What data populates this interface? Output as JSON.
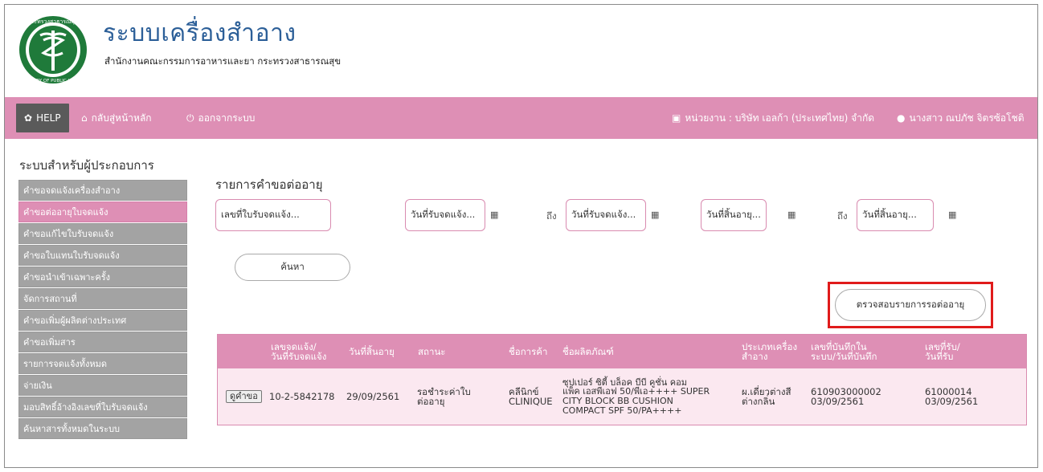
{
  "header": {
    "title": "ระบบเครื่องสำอาง",
    "subtitle": "สำนักงานคณะกรรมการอาหารและยา กระทรวงสาธารณสุข",
    "logo_text": "กระทรวงสาธารณสุข MINISTRY OF PUBLIC HEALTH"
  },
  "navbar": {
    "help": "HELP",
    "home": "กลับสู่หน้าหลัก",
    "logout": "ออกจากระบบ",
    "agency": "หน่วยงาน : บริษัท เอลก้า (ประเทศไทย) จำกัด",
    "user": "นางสาว ณปภัช จิตรซ้อโชติ"
  },
  "sidebar": {
    "title": "ระบบสำหรับผู้ประกอบการ",
    "items": [
      {
        "label": "คำขอจดแจ้งเครื่องสำอาง"
      },
      {
        "label": "คำขอต่ออายุใบจดแจ้ง"
      },
      {
        "label": "คำขอแก้ไขใบรับจดแจ้ง"
      },
      {
        "label": "คำขอใบแทนใบรับจดแจ้ง"
      },
      {
        "label": "คำขอนำเข้าเฉพาะครั้ง"
      },
      {
        "label": "จัดการสถานที่"
      },
      {
        "label": "คำขอเพิ่มผู้ผลิตต่างประเทศ"
      },
      {
        "label": "คำขอเพิ่มสาร"
      },
      {
        "label": "รายการจดแจ้งทั้งหมด"
      },
      {
        "label": "จ่ายเงิน"
      },
      {
        "label": "มอบสิทธิ์อ้างอิงเลขที่ใบรับจดแจ้ง"
      },
      {
        "label": "ค้นหาสารทั้งหมดในระบบ"
      }
    ]
  },
  "main": {
    "title": "รายการคำขอต่ออายุ",
    "filters": {
      "reg_no_placeholder": "เลขที่ใบรับจดแจ้ง...",
      "recv_from_placeholder": "วันที่รับจดแจ้ง...",
      "recv_to_placeholder": "วันที่รับจดแจ้ง...",
      "exp_from_placeholder": "วันที่สิ้นอายุ...",
      "exp_to_placeholder": "วันที่สิ้นอายุ...",
      "to_label": "ถึง"
    },
    "search_button": "ค้นหา",
    "check_button": "ตรวจสอบรายการรอต่ออายุ",
    "table": {
      "headers": {
        "reg": "เลขจดแจ้ง/\nวันที่รับจดแจ้ง",
        "expire": "วันที่สิ้นอายุ",
        "status": "สถานะ",
        "brand": "ชื่อการค้า",
        "product": "ชื่อผลิตภัณฑ์",
        "type": "ประเภทเครื่อง\nสำอาง",
        "system_no": "เลขที่บันทึกใน\nระบบ/วันที่บันทึก",
        "recv_no": "เลขที่รับ/\nวันที่รับ"
      },
      "rows": [
        {
          "view": "ดูคำขอ",
          "reg": "10-2-5842178",
          "expire": "29/09/2561",
          "status": "รอชำระค่าใบ\nต่ออายุ",
          "brand": "คลีนิกข์\nCLINIQUE",
          "product": "ซุปเปอร์ ซิตี้ บล็อค บีบี คูชั่น คอม\nแพ็ค เอสพีเอฟ 50/พีเอ++++ SUPER\nCITY BLOCK BB CUSHION\nCOMPACT SPF 50/PA++++",
          "type": "ผ.เดี่ยวต่างสี\nต่างกลิ่น",
          "system_no": "610903000002\n03/09/2561",
          "recv_no": "61000014\n03/09/2561"
        }
      ]
    }
  },
  "colors": {
    "accent": "#de8fb5",
    "title_blue": "#2c5f98",
    "sidebar_grey": "#a3a3a3",
    "highlight_red": "#e01b1b"
  }
}
